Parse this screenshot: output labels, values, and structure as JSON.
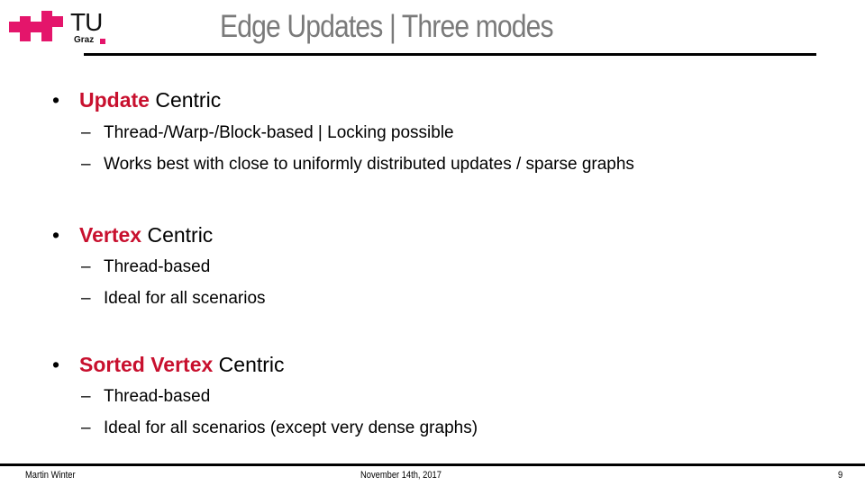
{
  "logo": {
    "name": "TU",
    "sub": "Graz"
  },
  "title": "Edge Updates | Three modes",
  "bullets": [
    {
      "highlight": "Update",
      "rest": " Centric",
      "subs": [
        "Thread-/Warp-/Block-based | Locking possible",
        "Works best with close to uniformly distributed updates / sparse graphs"
      ]
    },
    {
      "highlight": "Vertex",
      "rest": " Centric",
      "subs": [
        "Thread-based",
        "Ideal for all scenarios"
      ]
    },
    {
      "highlight": "Sorted Vertex",
      "rest": " Centric",
      "subs": [
        "Thread-based",
        "Ideal for all scenarios (except very dense graphs)"
      ]
    }
  ],
  "footer": {
    "author": "Martin Winter",
    "date": "November 14th, 2017",
    "page": "9"
  },
  "symbols": {
    "bullet": "•",
    "dash": "–"
  },
  "colors": {
    "accent": "#c8102e",
    "logo": "#e4156b",
    "title": "#7a7a7a"
  }
}
